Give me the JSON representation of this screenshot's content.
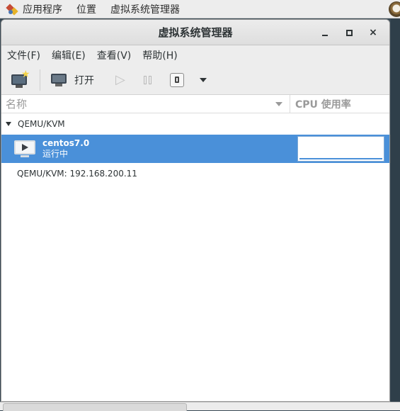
{
  "top_panel": {
    "items": [
      "应用程序",
      "位置",
      "虚拟系统管理器"
    ]
  },
  "window": {
    "title": "虚拟系统管理器",
    "close_glyph": "×"
  },
  "menubar": {
    "items": [
      "文件(F)",
      "编辑(E)",
      "查看(V)",
      "帮助(H)"
    ]
  },
  "toolbar": {
    "open_label": "打开"
  },
  "list": {
    "columns": {
      "name": "名称",
      "cpu": "CPU 使用率"
    },
    "groups": [
      {
        "name": "QEMU/KVM",
        "vms": [
          {
            "name": "centos7.0",
            "status": "运行中",
            "selected": true
          }
        ]
      }
    ],
    "connections": [
      "QEMU/KVM: 192.168.200.11"
    ]
  },
  "colors": {
    "selection": "#4a90d9",
    "panel_bg": "#ededed"
  }
}
